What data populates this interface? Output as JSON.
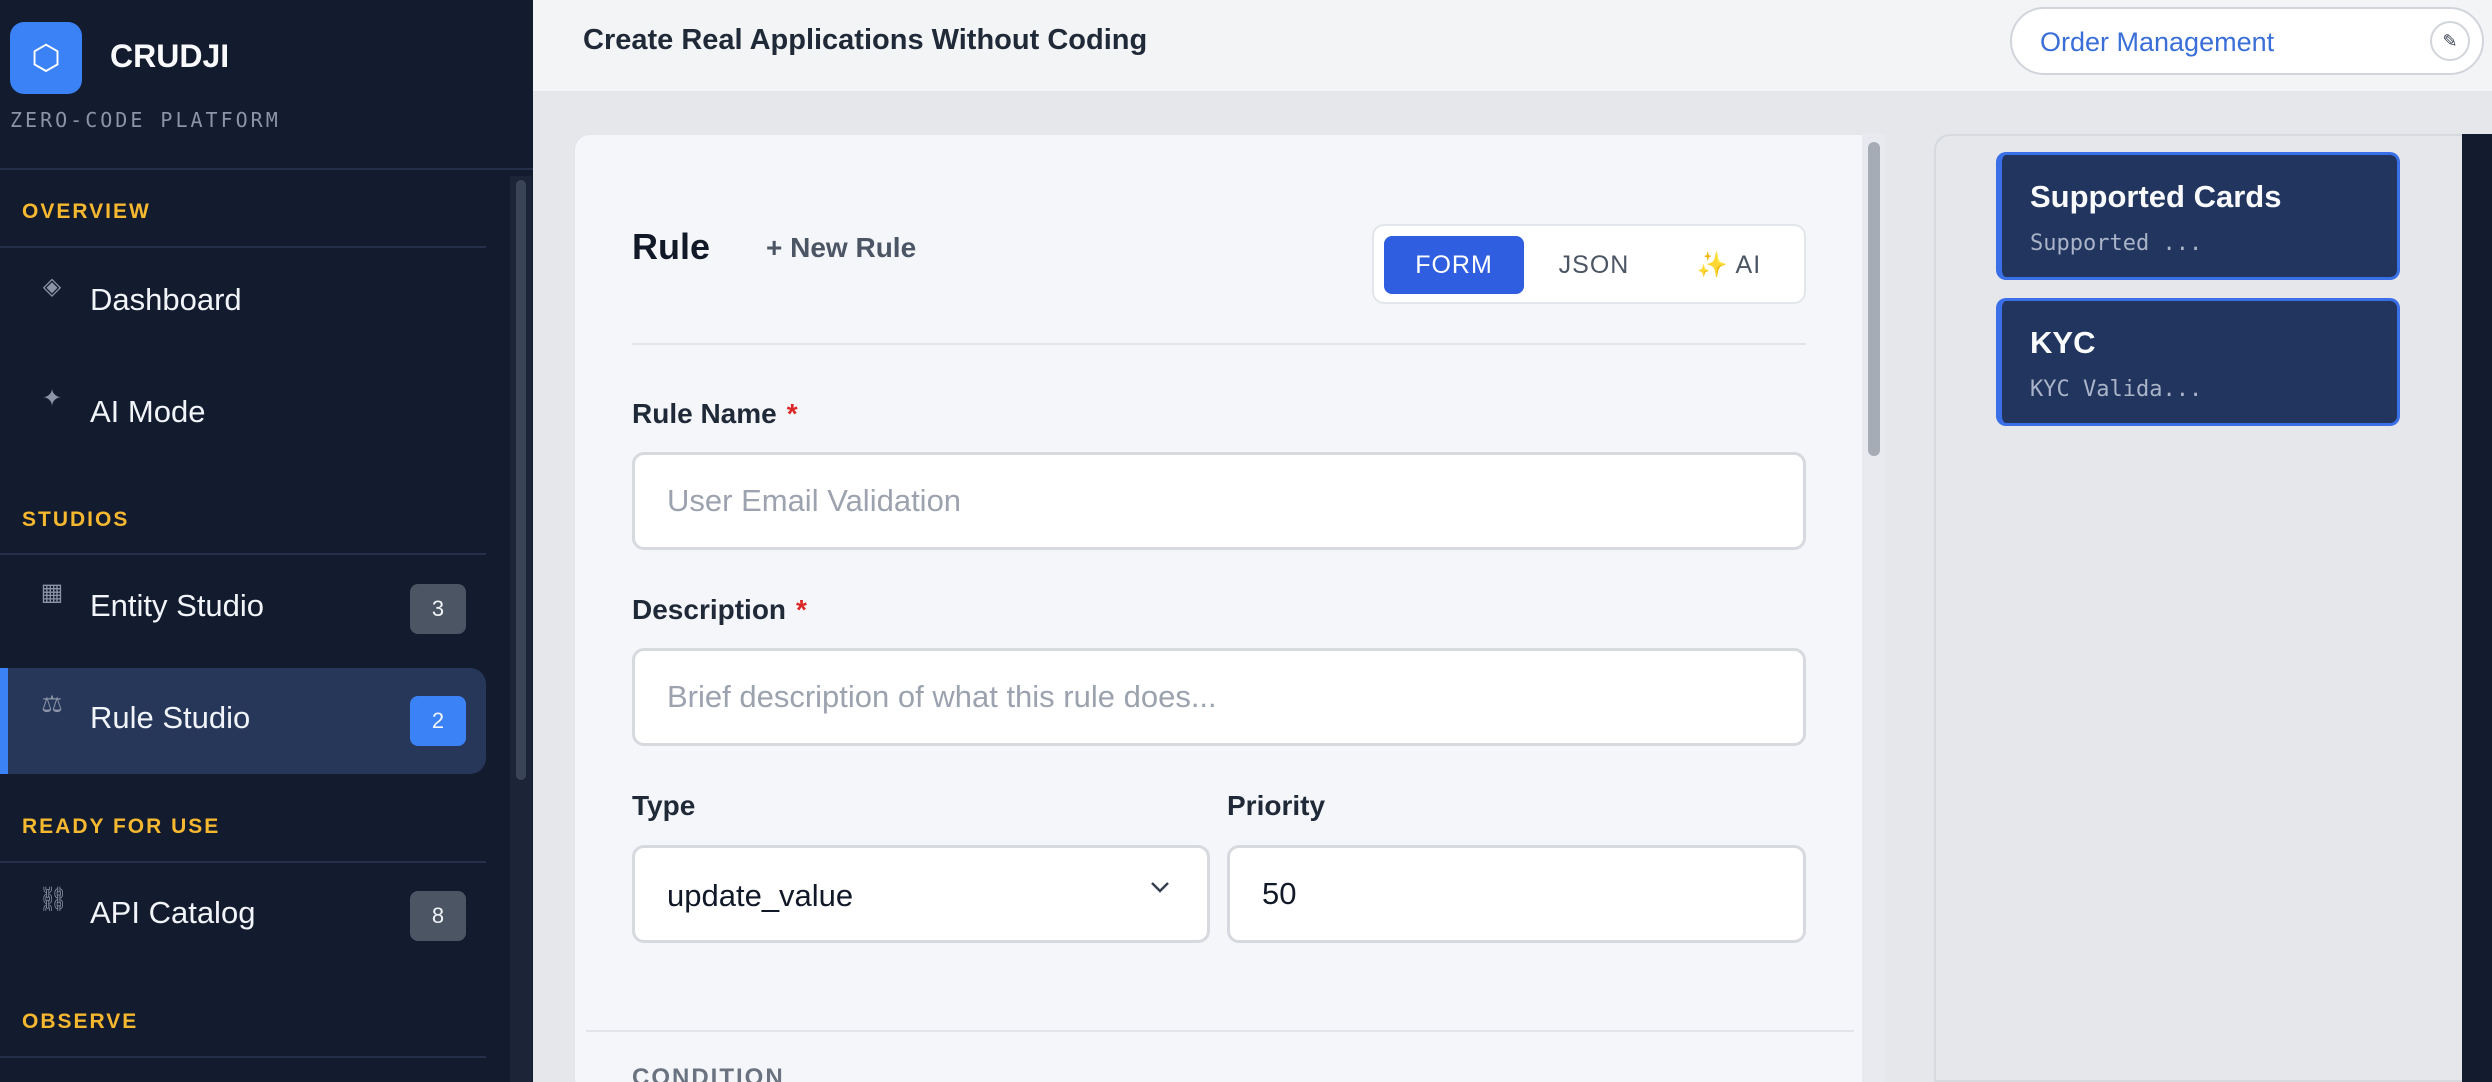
{
  "brand": {
    "logo_glyph": "⬡",
    "name": "CRUDJI",
    "subtitle": "ZERO-CODE PLATFORM"
  },
  "sidebar": {
    "sections": [
      {
        "title": "OVERVIEW"
      },
      {
        "title": "STUDIOS"
      },
      {
        "title": "READY FOR USE"
      },
      {
        "title": "OBSERVE"
      }
    ],
    "items": [
      {
        "label": "Dashboard",
        "icon": "◈",
        "icon_name": "dashboard-icon",
        "badge": ""
      },
      {
        "label": "AI Mode",
        "icon": "✦",
        "icon_name": "sparkle-icon",
        "badge": ""
      },
      {
        "label": "Entity Studio",
        "icon": "▦",
        "icon_name": "grid-icon",
        "badge": "3"
      },
      {
        "label": "Rule Studio",
        "icon": "⚖",
        "icon_name": "scales-icon",
        "badge": "2",
        "active": true
      },
      {
        "label": "API Catalog",
        "icon": "⛓",
        "icon_name": "chain-icon",
        "badge": "8"
      }
    ]
  },
  "header": {
    "title": "Create Real Applications Without Coding",
    "project_name": "Order Management",
    "edit_icon": "✎"
  },
  "editor": {
    "title": "Rule",
    "new_rule_label": "+ New Rule",
    "modes": [
      "FORM",
      "JSON",
      "✨ AI"
    ],
    "active_mode": "FORM",
    "rule_name_label": "Rule Name",
    "rule_name_placeholder": "User Email Validation",
    "rule_name_value": "",
    "description_label": "Description",
    "description_placeholder": "Brief description of what this rule does...",
    "description_value": "",
    "required_marker": "*",
    "type_label": "Type",
    "type_value": "update_value",
    "priority_label": "Priority",
    "priority_value": "50",
    "condition_label": "CONDITION"
  },
  "rules_list": [
    {
      "title": "Supported Cards",
      "subtitle": "Supported ..."
    },
    {
      "title": "KYC",
      "subtitle": "KYC Valida..."
    }
  ],
  "colors": {
    "accent": "#3b82f6",
    "section": "#f5b82e",
    "sidebar_bg": "#131b2e",
    "required": "#dc2626"
  }
}
